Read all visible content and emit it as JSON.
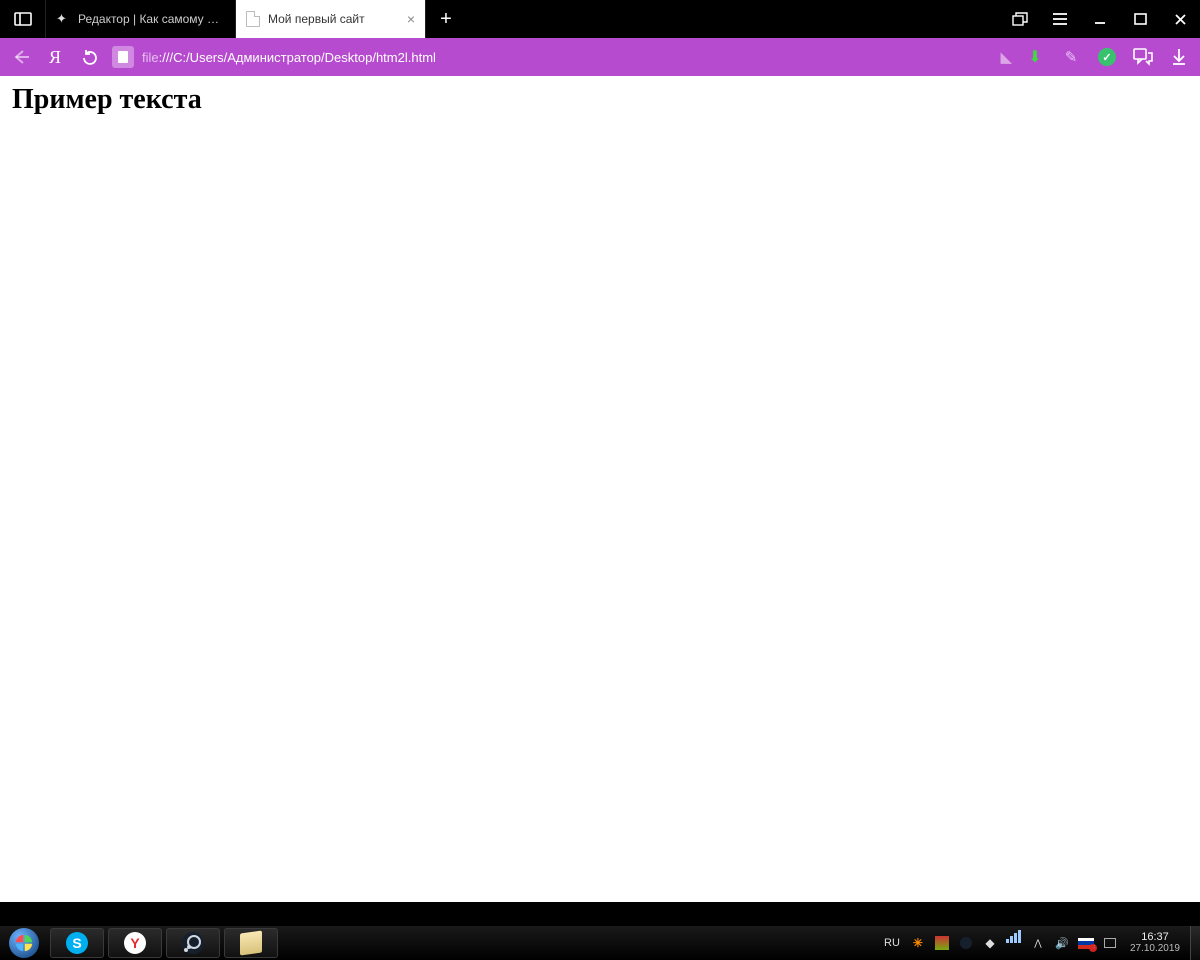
{
  "tabs": [
    {
      "label": "Редактор | Как самому нап",
      "active": false
    },
    {
      "label": "Мой первый сайт",
      "active": true
    }
  ],
  "addressbar": {
    "url_prefix": "file",
    "url_rest": ":///C:/Users/Администратор/Desktop/htm2l.html"
  },
  "page": {
    "heading": "Пример текста"
  },
  "taskbar": {
    "language": "RU",
    "clock": {
      "time": "16:37",
      "date": "27.10.2019"
    }
  }
}
